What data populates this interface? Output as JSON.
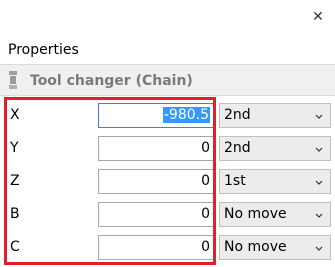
{
  "window": {
    "close_glyph": "✕"
  },
  "panel": {
    "title": "Properties",
    "header_label": "Tool changer (Chain)",
    "header_icon": "tool-changer-icon"
  },
  "rows": [
    {
      "axis": "X",
      "value": "-980.5",
      "mode": "2nd",
      "selected": true
    },
    {
      "axis": "Y",
      "value": "0",
      "mode": "2nd",
      "selected": false
    },
    {
      "axis": "Z",
      "value": "0",
      "mode": "1st",
      "selected": false
    },
    {
      "axis": "B",
      "value": "0",
      "mode": "No move",
      "selected": false
    },
    {
      "axis": "C",
      "value": "0",
      "mode": "No move",
      "selected": false
    }
  ],
  "colors": {
    "highlight": "#e0202a",
    "selection": "#3399ff",
    "focus_border": "#3b7fd8",
    "header_bg": "#f0f0f0",
    "combo_bg": "#ececec"
  }
}
